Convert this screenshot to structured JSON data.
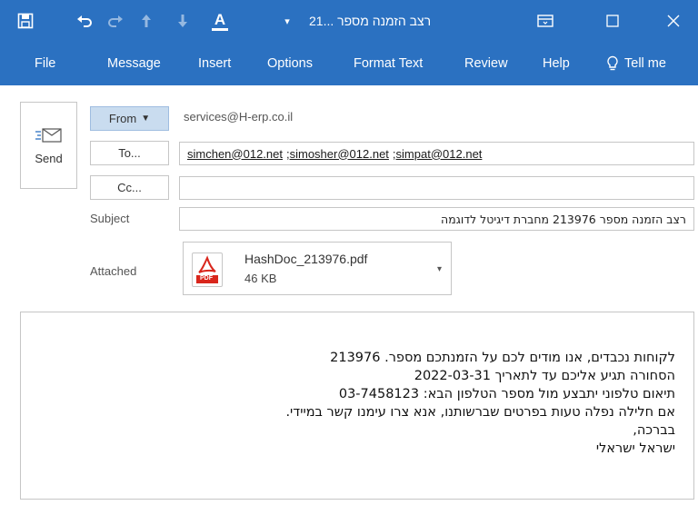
{
  "titlebar": {
    "title": "רצב הזמנה מספר ...21",
    "icons": [
      "save-icon",
      "undo-icon",
      "redo-icon",
      "up-icon",
      "down-icon",
      "font-color-icon",
      "customize-qat-icon",
      "ribbon-display-icon",
      "maximize-icon",
      "close-icon"
    ],
    "font_color_letter": "A"
  },
  "ribbon": {
    "tabs": [
      "File",
      "Message",
      "Insert",
      "Options",
      "Format Text",
      "Review",
      "Help",
      "Tell me"
    ]
  },
  "header": {
    "send_label": "Send",
    "from_button": "From",
    "to_button": "To...",
    "cc_button": "Cc...",
    "from_value": "services@H-erp.co.il",
    "to_recipients": [
      "simchen@012.net",
      "simosher@012.net",
      "simpat@012.net"
    ],
    "to_separator": ";",
    "cc_value": "",
    "subject_label": "Subject",
    "subject_value": "רצב הזמנה מספר 213976 מחברת דיגיטל לדוגמה",
    "attached_label": "Attached",
    "attachment": {
      "name": "HashDoc_213976.pdf",
      "size": "46 KB",
      "icon": "pdf-icon",
      "icon_label": "PDF"
    }
  },
  "body": {
    "lines": [
      "לקוחות נכבדים, אנו מודים לכם על הזמנתכם מספר. 213976",
      "הסחורה תגיע אליכם עד לתאריך 2022-03-31",
      "תיאום טלפוני יתבצע מול מספר הטלפון הבא: 03-7458123",
      "אם חלילה נפלה טעות בפרטים שברשותנו, אנא צרו עימנו קשר במיידי.",
      "בברכה,",
      "ישראל ישראלי"
    ]
  },
  "colors": {
    "titlebar": "#2b71c1",
    "from_button_bg": "#c9dcef",
    "border": "#c6c6c6",
    "pdf_red": "#d9261c"
  }
}
